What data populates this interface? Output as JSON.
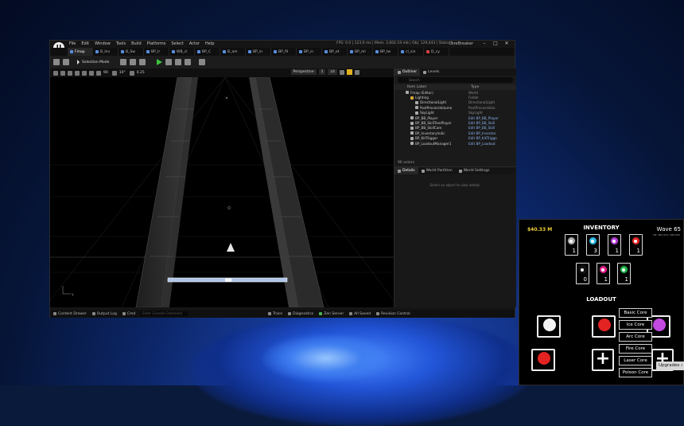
{
  "editor": {
    "menu": [
      "File",
      "Edit",
      "Window",
      "Tools",
      "Build",
      "Platforms",
      "Select",
      "Actor",
      "Help"
    ],
    "stats": "FPS: 0.0  |  123.0 ms  |  Mem: 3,602.19 mb  |  Obj: 129,443  |  Stats: 4",
    "project": "CoreBreaker",
    "tabs": [
      "Fmap",
      "B_Inv",
      "B_Sw",
      "BP_Ir",
      "WB_cl",
      "BP_C",
      "B_am",
      "BP_in",
      "BP_fil",
      "BP_in",
      "BP_et",
      "BP_ml",
      "BP_Iw",
      "cl_sin",
      "D_cy"
    ],
    "active_tab": "Fmap",
    "selection_mode": "Selection Mode",
    "viewport": {
      "perspective": "Perspective",
      "lit": "Lit",
      "snap_angle": "10°",
      "snap_grid": "90",
      "scale": "0.25",
      "camera_speed": "1",
      "tooltip_text": "▓▓▓",
      "axis_label": "Y"
    },
    "outliner": {
      "tab_outliner": "Outliner",
      "tab_levels": "Levels",
      "search_placeholder": "Search",
      "col_label": "Item Label",
      "col_type": "Type",
      "rows": [
        {
          "name": "Fmap (Editor)",
          "type": "World",
          "kind": "world"
        },
        {
          "name": "Lighting",
          "type": "Folder",
          "kind": "folder"
        },
        {
          "name": "DirectionalLight",
          "type": "DirectionalLight",
          "kind": "item"
        },
        {
          "name": "PostProcessVolume",
          "type": "PostProcessVolu",
          "kind": "item"
        },
        {
          "name": "SkyLight",
          "type": "SkyLight",
          "kind": "item"
        },
        {
          "name": "BP_BB_Player",
          "type": "Edit BP_BB_Player",
          "kind": "bp"
        },
        {
          "name": "BP_BB_SkillTreePlayer",
          "type": "Edit BP_BB_Skill",
          "kind": "bp"
        },
        {
          "name": "BP_BB_SkillCam",
          "type": "Edit BP_BB_Skill",
          "kind": "bp"
        },
        {
          "name": "BP_InventoryIndic",
          "type": "Edit BP_Inventor",
          "kind": "bp"
        },
        {
          "name": "BP_KillTrigger",
          "type": "Edit BP_KillTrigge",
          "kind": "bp"
        },
        {
          "name": "BP_LoadoutManager1",
          "type": "Edit BP_Loadout",
          "kind": "bp"
        }
      ],
      "actor_count": "96 actors"
    },
    "details": {
      "tab_details": "Details",
      "tab_world_partition": "World Partition",
      "tab_world_settings": "World Settings",
      "empty_text": "Select an object to view details."
    },
    "bottom_bar": {
      "content_drawer": "Content Drawer",
      "output_log": "Output Log",
      "cmd": "Cmd",
      "cmd_placeholder": "Enter Console Command",
      "trace": "Trace",
      "diagnostics": "Diagnostics",
      "zen_server": "Zen Server",
      "all_saved": "All Saved",
      "revision_control": "Revision Control"
    }
  },
  "game": {
    "money": "$40.33 M",
    "wave": "Wave 65",
    "wave_sub": "HP: 365,474 / 587,093",
    "inventory_title": "INVENTORY",
    "inventory": [
      {
        "color": "#aaaaaa",
        "count": "1"
      },
      {
        "color": "#29b6e8",
        "count": "3"
      },
      {
        "color": "#b53ad8",
        "count": "1"
      },
      {
        "color": "#e62222",
        "count": "1"
      },
      {
        "color": "#111111",
        "count": "0"
      },
      {
        "color": "#e41a8a",
        "count": "1"
      },
      {
        "color": "#1fb84a",
        "count": "1"
      }
    ],
    "loadout_title": "LOADOUT",
    "cores": [
      "Basic Core",
      "Ice Core",
      "Arc Core",
      "Fire Core",
      "Laser Core",
      "Poison Core"
    ],
    "upgrades_label": "Upgrades",
    "slot_colors": {
      "white": "#f2f2f2",
      "red": "#e32222",
      "purple": "#c24ae0"
    }
  }
}
